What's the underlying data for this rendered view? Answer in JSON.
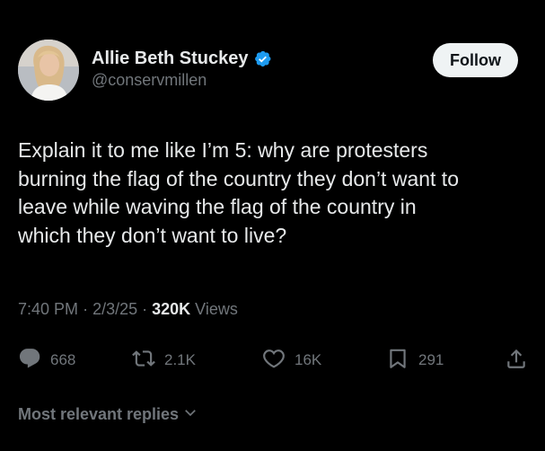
{
  "author": {
    "display_name": "Allie Beth Stuckey",
    "handle": "@conservmillen",
    "verified": true
  },
  "follow_label": "Follow",
  "tweet": {
    "lines": [
      "Explain it to me like I’m 5: why are protesters",
      "burning the flag of the country they don’t want to",
      "leave while waving the flag of the country in",
      "which they don’t want to live?"
    ]
  },
  "meta": {
    "time": "7:40 PM",
    "date": "2/3/25",
    "separator": "·",
    "views_count": "320K",
    "views_label": "Views"
  },
  "actions": {
    "replies": "668",
    "reposts": "2.1K",
    "likes": "16K",
    "bookmarks": "291"
  },
  "replies_sort": {
    "label": "Most relevant replies"
  },
  "icons": {
    "reply": "reply-icon",
    "repost": "repost-icon",
    "like": "heart-icon",
    "bookmark": "bookmark-icon",
    "share": "share-icon",
    "verified": "verified-badge-icon",
    "dropdown": "chevron-down-icon"
  },
  "colors": {
    "background": "#000000",
    "text_primary": "#e7e9ea",
    "text_secondary": "#71767b",
    "verified_blue": "#1d9bf0",
    "follow_bg": "#eff3f4"
  }
}
